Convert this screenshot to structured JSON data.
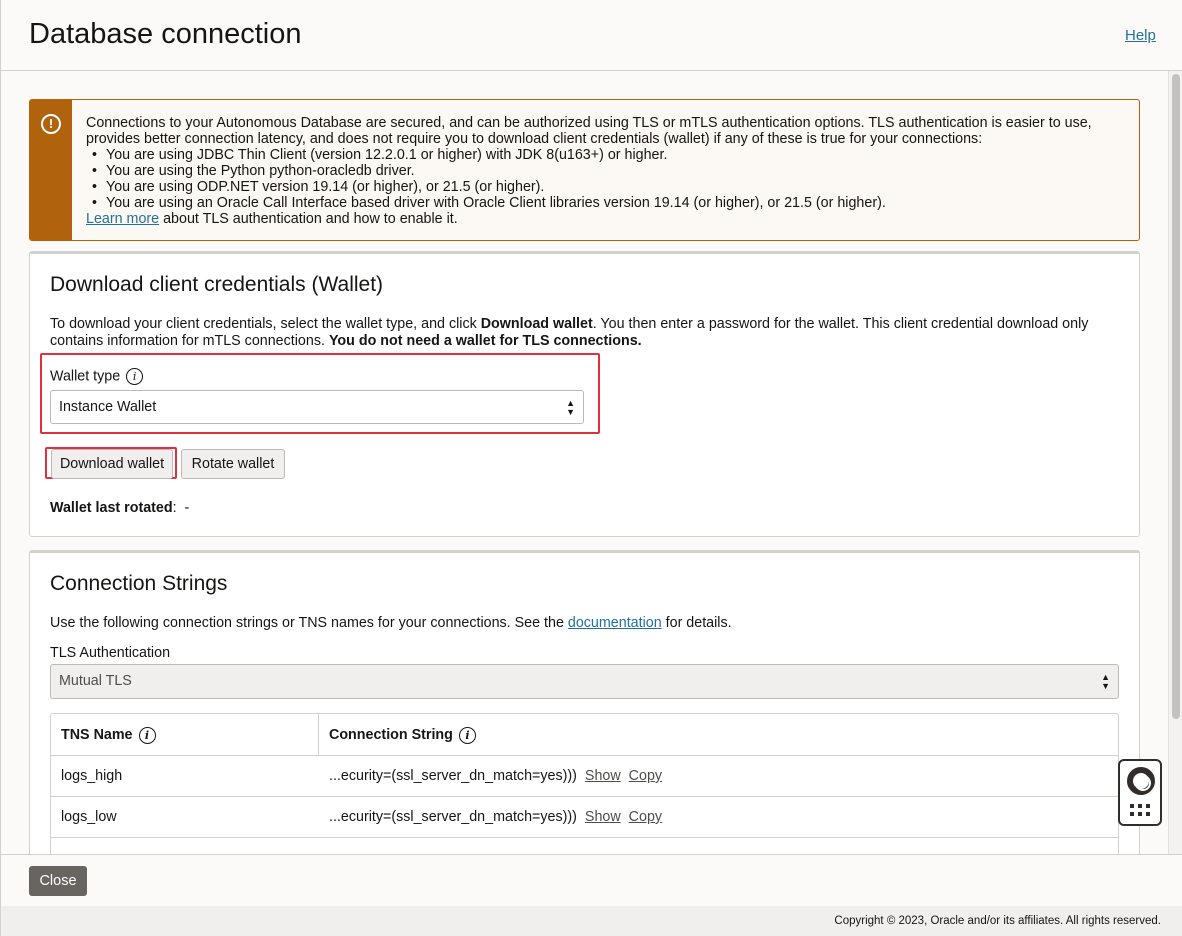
{
  "header": {
    "title": "Database connection",
    "help": "Help"
  },
  "warning": {
    "intro": "Connections to your Autonomous Database are secured, and can be authorized using TLS or mTLS authentication options. TLS authentication is easier to use, provides better connection latency, and does not require you to download client credentials (wallet) if any of these is true for your connections:",
    "bullets": [
      "You are using JDBC Thin Client (version 12.2.0.1 or higher) with JDK 8(u163+) or higher.",
      "You are using the Python python-oracledb driver.",
      "You are using ODP.NET version 19.14 (or higher), or 21.5 (or higher).",
      "You are using an Oracle Call Interface based driver with Oracle Client libraries version 19.14 (or higher), or 21.5 (or higher)."
    ],
    "learn_more": "Learn more",
    "learn_more_tail": " about TLS authentication and how to enable it."
  },
  "wallet": {
    "title": "Download client credentials (Wallet)",
    "desc_a": "To download your client credentials, select the wallet type, and click ",
    "desc_b": "Download wallet",
    "desc_c": ". You then enter a password for the wallet. This client credential download only contains information for mTLS connections. ",
    "desc_d": "You do not need a wallet for TLS connections.",
    "type_label": "Wallet type",
    "type_value": "Instance Wallet",
    "download_btn": "Download wallet",
    "rotate_btn": "Rotate wallet",
    "last_rotated_label": "Wallet last rotated",
    "last_rotated_sep": ":",
    "last_rotated_value": "-"
  },
  "conn": {
    "title": "Connection Strings",
    "desc_a": "Use the following connection strings or TNS names for your connections. See the ",
    "desc_link": "documentation",
    "desc_b": " for details.",
    "tls_label": "TLS Authentication",
    "tls_value": "Mutual TLS",
    "col_tns": "TNS Name",
    "col_conn": "Connection String",
    "rows": [
      {
        "name": "logs_high",
        "conn": "...ecurity=(ssl_server_dn_match=yes)))",
        "show": "Show",
        "copy": "Copy"
      },
      {
        "name": "logs_low",
        "conn": "...ecurity=(ssl_server_dn_match=yes)))",
        "show": "Show",
        "copy": "Copy"
      }
    ]
  },
  "footer": {
    "close": "Close",
    "copyright": "Copyright © 2023, Oracle and/or its affiliates. All rights reserved."
  },
  "icons": {
    "warning": "warning-icon",
    "info": "info-icon",
    "select": "chevron-updown-icon",
    "help": "lifering-icon",
    "apps": "apps-grid-icon"
  }
}
